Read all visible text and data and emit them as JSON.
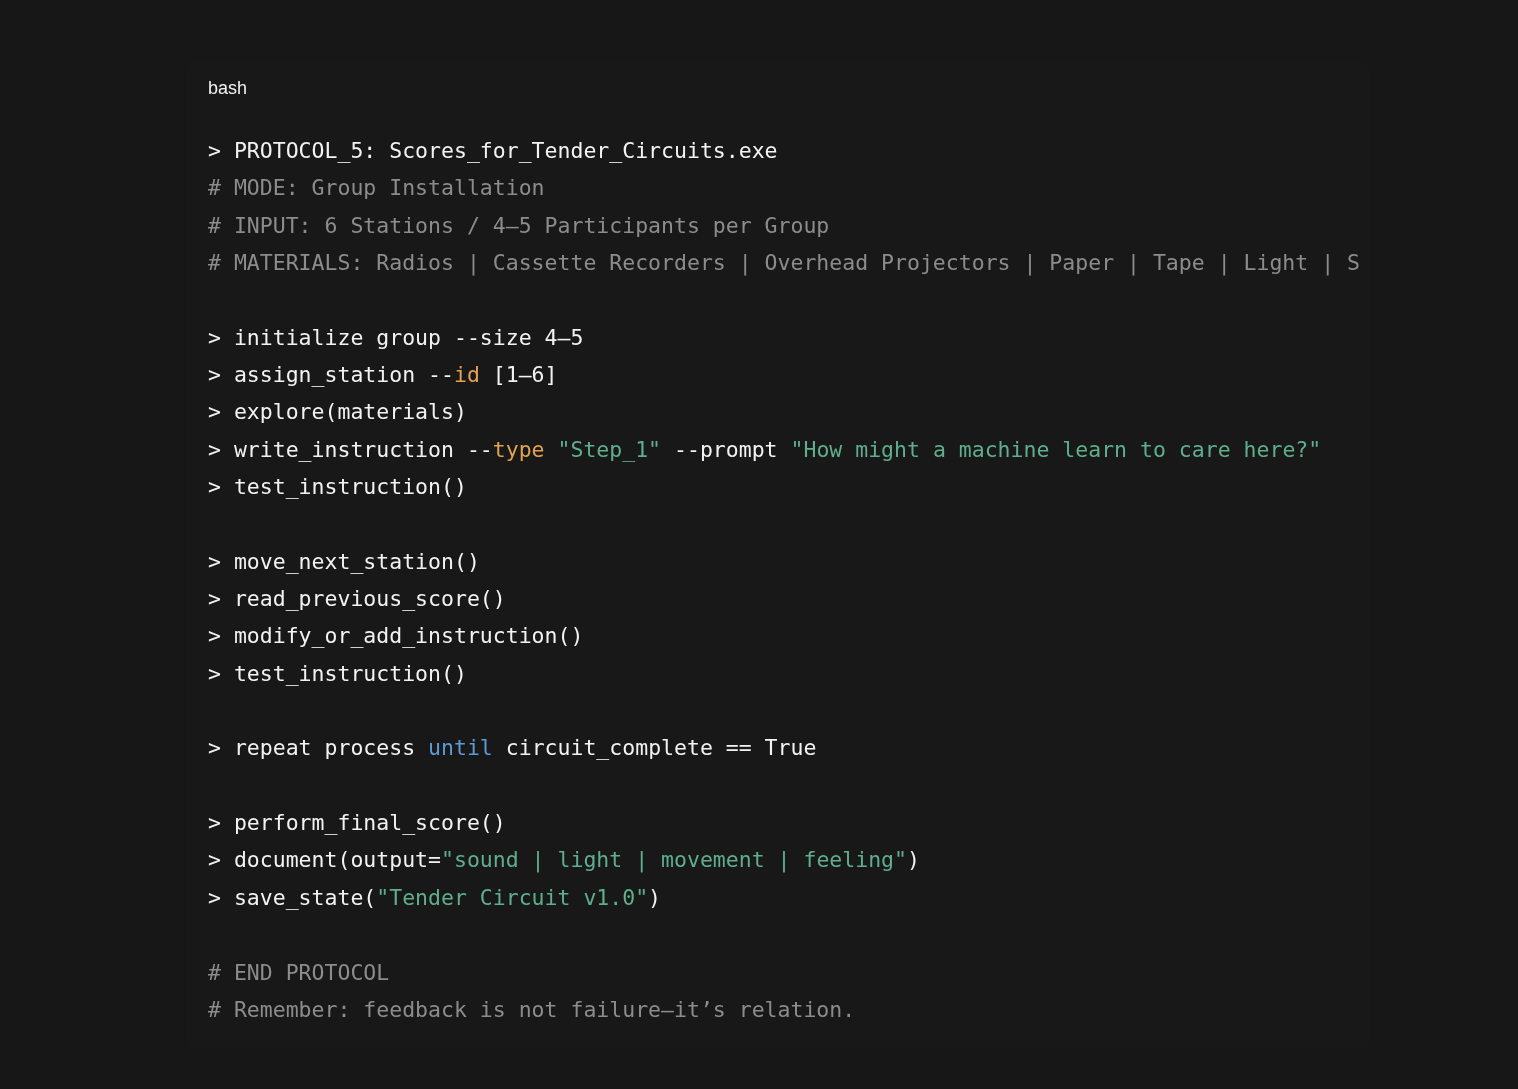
{
  "code_block": {
    "language": "bash",
    "groups": [
      [
        {
          "tokens": [
            {
              "text": "> PROTOCOL_5: Scores_for_Tender_Circuits.exe",
              "kind": "plain"
            }
          ]
        },
        {
          "tokens": [
            {
              "text": "# MODE: Group Installation",
              "kind": "comment"
            }
          ]
        },
        {
          "tokens": [
            {
              "text": "# INPUT: 6 Stations / 4–5 Participants per Group",
              "kind": "comment"
            }
          ]
        },
        {
          "tokens": [
            {
              "text": "# MATERIALS: Radios | Cassette Recorders | Overhead Projectors | Paper | Tape | Light | S",
              "kind": "comment"
            }
          ]
        }
      ],
      [
        {
          "tokens": [
            {
              "text": "> initialize group --size 4–5",
              "kind": "plain"
            }
          ]
        },
        {
          "tokens": [
            {
              "text": "> assign_station --",
              "kind": "plain"
            },
            {
              "text": "id",
              "kind": "param"
            },
            {
              "text": " [1–6]",
              "kind": "plain"
            }
          ]
        },
        {
          "tokens": [
            {
              "text": "> explore(materials)",
              "kind": "plain"
            }
          ]
        },
        {
          "tokens": [
            {
              "text": "> write_instruction --",
              "kind": "plain"
            },
            {
              "text": "type",
              "kind": "param"
            },
            {
              "text": " \"Step_1\"",
              "kind": "string"
            },
            {
              "text": " --prompt ",
              "kind": "plain"
            },
            {
              "text": "\"How might a machine learn to care here?\"",
              "kind": "string"
            }
          ]
        },
        {
          "tokens": [
            {
              "text": "> test_instruction()",
              "kind": "plain"
            }
          ]
        }
      ],
      [
        {
          "tokens": [
            {
              "text": "> move_next_station()",
              "kind": "plain"
            }
          ]
        },
        {
          "tokens": [
            {
              "text": "> read_previous_score()",
              "kind": "plain"
            }
          ]
        },
        {
          "tokens": [
            {
              "text": "> modify_or_add_instruction()",
              "kind": "plain"
            }
          ]
        },
        {
          "tokens": [
            {
              "text": "> test_instruction()",
              "kind": "plain"
            }
          ]
        }
      ],
      [
        {
          "tokens": [
            {
              "text": "> repeat process ",
              "kind": "plain"
            },
            {
              "text": "until",
              "kind": "keyword"
            },
            {
              "text": " circuit_complete == True",
              "kind": "plain"
            }
          ]
        }
      ],
      [
        {
          "tokens": [
            {
              "text": "> perform_final_score()",
              "kind": "plain"
            }
          ]
        },
        {
          "tokens": [
            {
              "text": "> document(output=",
              "kind": "plain"
            },
            {
              "text": "\"sound | light | movement | feeling\"",
              "kind": "string"
            },
            {
              "text": ")",
              "kind": "plain"
            }
          ]
        },
        {
          "tokens": [
            {
              "text": "> save_state(",
              "kind": "plain"
            },
            {
              "text": "\"Tender Circuit v1.0\"",
              "kind": "string"
            },
            {
              "text": ")",
              "kind": "plain"
            }
          ]
        }
      ],
      [
        {
          "tokens": [
            {
              "text": "# END PROTOCOL",
              "kind": "comment"
            }
          ]
        },
        {
          "tokens": [
            {
              "text": "# Remember: feedback is not failure—it’s relation.",
              "kind": "comment"
            }
          ]
        }
      ]
    ]
  }
}
